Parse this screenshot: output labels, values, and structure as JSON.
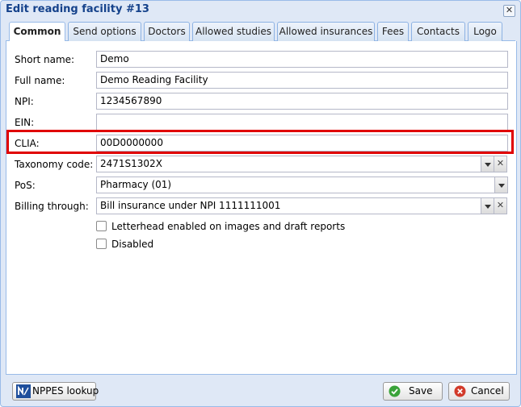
{
  "window": {
    "title": "Edit reading facility #13",
    "close_glyph": "✕"
  },
  "tabs": [
    {
      "label": "Common",
      "active": true
    },
    {
      "label": "Send options"
    },
    {
      "label": "Doctors"
    },
    {
      "label": "Allowed studies"
    },
    {
      "label": "Allowed insurances"
    },
    {
      "label": "Fees"
    },
    {
      "label": "Contacts"
    },
    {
      "label": "Logo"
    }
  ],
  "form": {
    "short_name": {
      "label": "Short name:",
      "value": "Demo"
    },
    "full_name": {
      "label": "Full name:",
      "value": "Demo Reading Facility"
    },
    "npi": {
      "label": "NPI:",
      "value": "1234567890"
    },
    "ein": {
      "label": "EIN:",
      "value": ""
    },
    "clia": {
      "label": "CLIA:",
      "value": "00D0000000"
    },
    "taxonomy": {
      "label": "Taxonomy code:",
      "value": "2471S1302X"
    },
    "pos": {
      "label": "PoS:",
      "value": "Pharmacy (01)"
    },
    "billing": {
      "label": "Billing through:",
      "value": "Bill insurance under NPI 1111111001"
    },
    "letterhead": {
      "label": "Letterhead enabled on images and draft reports",
      "checked": false
    },
    "disabled": {
      "label": "Disabled",
      "checked": false
    }
  },
  "footer": {
    "nppes_label": "NPPES lookup",
    "save_label": "Save",
    "cancel_label": "Cancel"
  },
  "colors": {
    "highlight": "#e00000",
    "title": "#15428b",
    "window_bg": "#dfe8f6",
    "save_icon": "#3aa33a",
    "cancel_icon": "#d23a2a"
  }
}
